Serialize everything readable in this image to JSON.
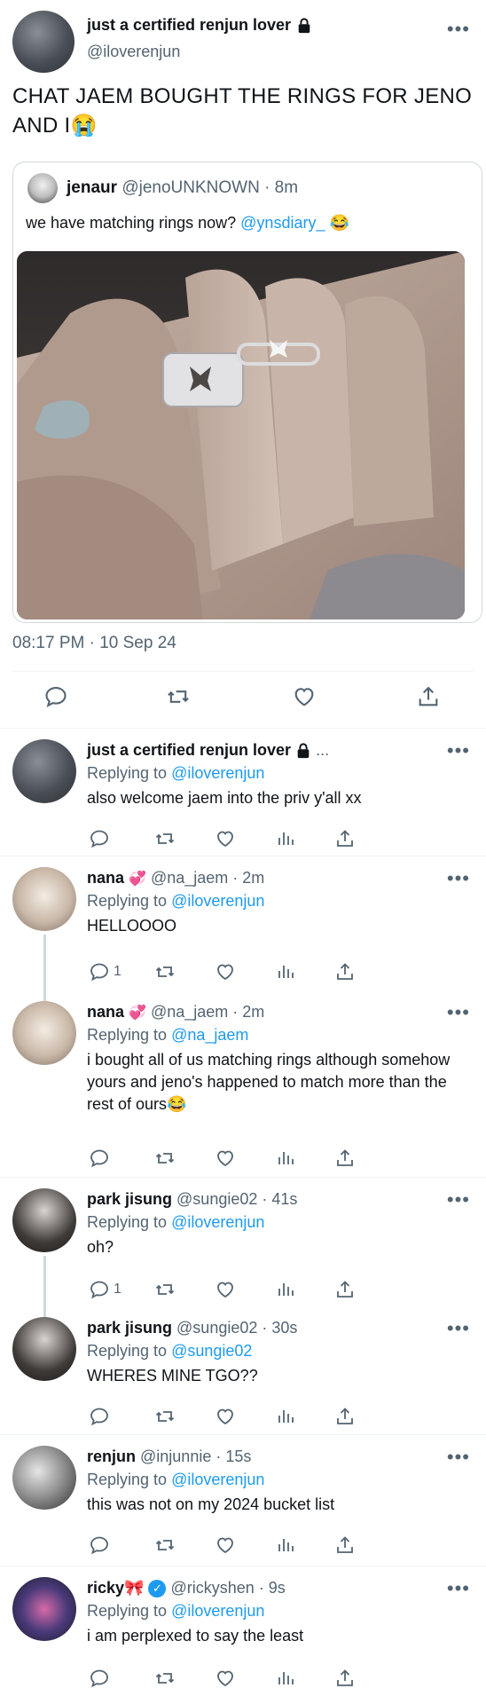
{
  "main_tweet": {
    "display_name": "just a certified renjun lover",
    "handle": "@iloverenjun",
    "text": "CHAT JAEM BOUGHT THE RINGS FOR JENO AND I😭",
    "quote": {
      "display_name": "jenaur",
      "handle_time": "@jenoUNKNOWN · 8m",
      "text_prefix": "we have matching rings now?",
      "mention": "@ynsdiary_",
      "emoji": "😂"
    },
    "timestamp": "08:17 PM · 10 Sep 24"
  },
  "replies": [
    {
      "display_name": "just a certified renjun lover",
      "meta": "...",
      "replying_prefix": "Replying to",
      "replying_to": "@iloverenjun",
      "text": "also welcome jaem into the priv y'all xx",
      "reply_count": ""
    },
    {
      "display_name": "nana",
      "meta": "@na_jaem · 2m",
      "replying_prefix": "Replying to",
      "replying_to": "@iloverenjun",
      "text": "HELLOOOO",
      "reply_count": "1"
    },
    {
      "display_name": "nana",
      "meta": "@na_jaem · 2m",
      "replying_prefix": "Replying to",
      "replying_to": "@na_jaem",
      "text": "i bought all of us matching rings although somehow yours and jeno's happened to match more than the rest of ours😂",
      "reply_count": ""
    },
    {
      "display_name": "park jisung",
      "meta": "@sungie02 · 41s",
      "replying_prefix": "Replying to",
      "replying_to": "@iloverenjun",
      "text": "oh?",
      "reply_count": "1"
    },
    {
      "display_name": "park jisung",
      "meta": "@sungie02 · 30s",
      "replying_prefix": "Replying to",
      "replying_to": "@sungie02",
      "text": "WHERES MINE TGO??",
      "reply_count": ""
    },
    {
      "display_name": "renjun",
      "meta": "@injunnie · 15s",
      "replying_prefix": "Replying to",
      "replying_to": "@iloverenjun",
      "text": "this was not on my 2024 bucket list",
      "reply_count": ""
    },
    {
      "display_name": "ricky🎀",
      "meta": "@rickyshen · 9s",
      "replying_prefix": "Replying to",
      "replying_to": "@iloverenjun",
      "text": "i am perplexed to say the least",
      "reply_count": ""
    }
  ],
  "colors": {
    "link": "#1d9bf0",
    "muted": "#536471",
    "text": "#0f1419",
    "divider": "#eff3f4"
  },
  "icons": [
    "lock-icon",
    "more-icon",
    "reply-icon",
    "retweet-icon",
    "like-icon",
    "views-icon",
    "share-icon",
    "verified-icon",
    "heart-emoji-icon"
  ]
}
